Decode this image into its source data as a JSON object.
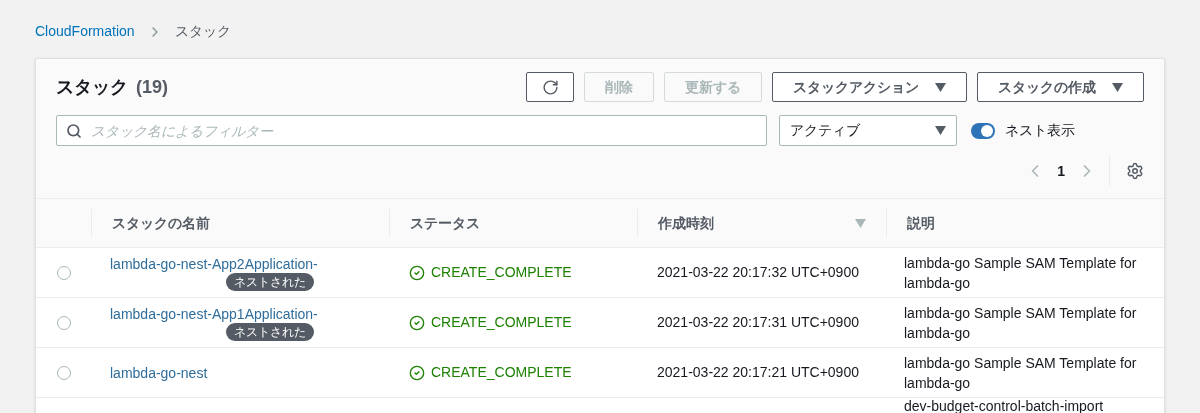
{
  "breadcrumb": [
    {
      "label": "CloudFormation",
      "kind": "link"
    },
    {
      "label": "スタック",
      "kind": "current"
    }
  ],
  "header": {
    "title": "スタック",
    "count": "(19)"
  },
  "buttons": [
    {
      "kind": "icon",
      "disabled": false
    },
    {
      "kind": "text",
      "label": "削除",
      "disabled": true
    },
    {
      "kind": "text",
      "label": "更新する",
      "disabled": true
    },
    {
      "kind": "dropdown",
      "label": "スタックアクション",
      "disabled": false
    },
    {
      "kind": "dropdown",
      "label": "スタックの作成",
      "disabled": false
    }
  ],
  "search": {
    "placeholder": "スタック名によるフィルター"
  },
  "status_filter": {
    "value": "アクティブ"
  },
  "nested_toggle": {
    "label": "ネスト表示",
    "on": true
  },
  "pagination": {
    "page": "1"
  },
  "table": {
    "columns": [
      {
        "label": "スタックの名前",
        "sorted": false
      },
      {
        "label": "ステータス",
        "sorted": false
      },
      {
        "label": "作成時刻",
        "sorted": true
      },
      {
        "label": "説明",
        "sorted": false
      }
    ],
    "rows": [
      {
        "selected": false,
        "name": "lambda-go-nest-App2Application-",
        "badge": "ネストされた",
        "status": "CREATE_COMPLETE",
        "created": "2021-03-22 20:17:32 UTC+0900",
        "description": "lambda-go Sample SAM Template for lambda-go"
      },
      {
        "selected": false,
        "name": "lambda-go-nest-App1Application-",
        "badge": "ネストされた",
        "status": "CREATE_COMPLETE",
        "created": "2021-03-22 20:17:31 UTC+0900",
        "description": "lambda-go Sample SAM Template for lambda-go"
      },
      {
        "selected": false,
        "name": "lambda-go-nest",
        "status": "CREATE_COMPLETE",
        "created": "2021-03-22 20:17:21 UTC+0900",
        "description": "lambda-go Sample SAM Template for lambda-go"
      }
    ],
    "partial_row": {
      "description": "dev-budget-control-batch-import"
    }
  }
}
